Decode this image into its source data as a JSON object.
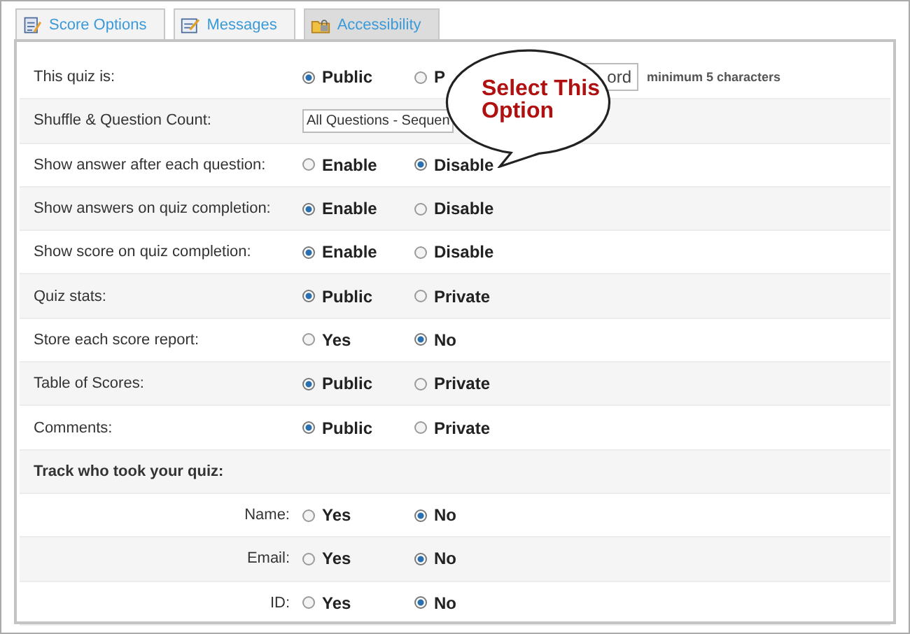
{
  "tabs": [
    {
      "label": "Score Options",
      "selected": false
    },
    {
      "label": "Messages",
      "selected": false
    },
    {
      "label": "Accessibility",
      "selected": true
    }
  ],
  "rows": [
    {
      "kind": "radio",
      "label": "This quiz is:",
      "options": [
        {
          "label": "Public",
          "selected": true
        },
        {
          "label": "P",
          "selected": false
        }
      ],
      "password": {
        "value": "ord",
        "hint": "minimum 5 characters"
      }
    },
    {
      "kind": "select",
      "label": "Shuffle & Question Count:",
      "value": "All Questions - Sequen"
    },
    {
      "kind": "radio",
      "label": "Show answer after each question:",
      "options": [
        {
          "label": "Enable",
          "selected": false
        },
        {
          "label": "Disable",
          "selected": true
        }
      ]
    },
    {
      "kind": "radio",
      "label": "Show answers on quiz completion:",
      "options": [
        {
          "label": "Enable",
          "selected": true
        },
        {
          "label": "Disable",
          "selected": false
        }
      ]
    },
    {
      "kind": "radio",
      "label": "Show score on quiz completion:",
      "options": [
        {
          "label": "Enable",
          "selected": true
        },
        {
          "label": "Disable",
          "selected": false
        }
      ]
    },
    {
      "kind": "radio",
      "label": "Quiz stats:",
      "options": [
        {
          "label": "Public",
          "selected": true
        },
        {
          "label": "Private",
          "selected": false
        }
      ]
    },
    {
      "kind": "radio",
      "label": "Store each score report:",
      "options": [
        {
          "label": "Yes",
          "selected": false
        },
        {
          "label": "No",
          "selected": true
        }
      ]
    },
    {
      "kind": "radio",
      "label": "Table of Scores:",
      "options": [
        {
          "label": "Public",
          "selected": true
        },
        {
          "label": "Private",
          "selected": false
        }
      ]
    },
    {
      "kind": "radio",
      "label": "Comments:",
      "options": [
        {
          "label": "Public",
          "selected": true
        },
        {
          "label": "Private",
          "selected": false
        }
      ]
    },
    {
      "kind": "heading",
      "label": "Track who took your quiz:"
    },
    {
      "kind": "subradio",
      "label": "Name:",
      "options": [
        {
          "label": "Yes",
          "selected": false
        },
        {
          "label": "No",
          "selected": true
        }
      ]
    },
    {
      "kind": "subradio",
      "label": "Email:",
      "options": [
        {
          "label": "Yes",
          "selected": false
        },
        {
          "label": "No",
          "selected": true
        }
      ]
    },
    {
      "kind": "subradio",
      "label": "ID:",
      "options": [
        {
          "label": "Yes",
          "selected": false
        },
        {
          "label": "No",
          "selected": true
        }
      ]
    }
  ],
  "callout": {
    "text": "Select This Option"
  }
}
